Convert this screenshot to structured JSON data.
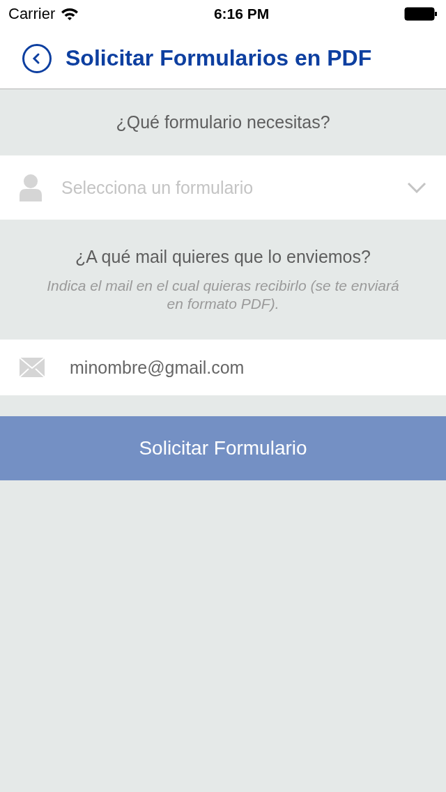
{
  "status_bar": {
    "carrier": "Carrier",
    "time": "6:16 PM"
  },
  "nav": {
    "title": "Solicitar Formularios en PDF"
  },
  "form_section": {
    "title": "¿Qué formulario necesitas?"
  },
  "form_select": {
    "placeholder": "Selecciona un formulario"
  },
  "mail_section": {
    "title": "¿A qué mail quieres que lo enviemos?",
    "hint": "Indica el mail en el cual quieras recibirlo (se te enviará en formato PDF)."
  },
  "mail_field": {
    "value": "minombre@gmail.com"
  },
  "submit_button": {
    "label": "Solicitar Formulario"
  }
}
